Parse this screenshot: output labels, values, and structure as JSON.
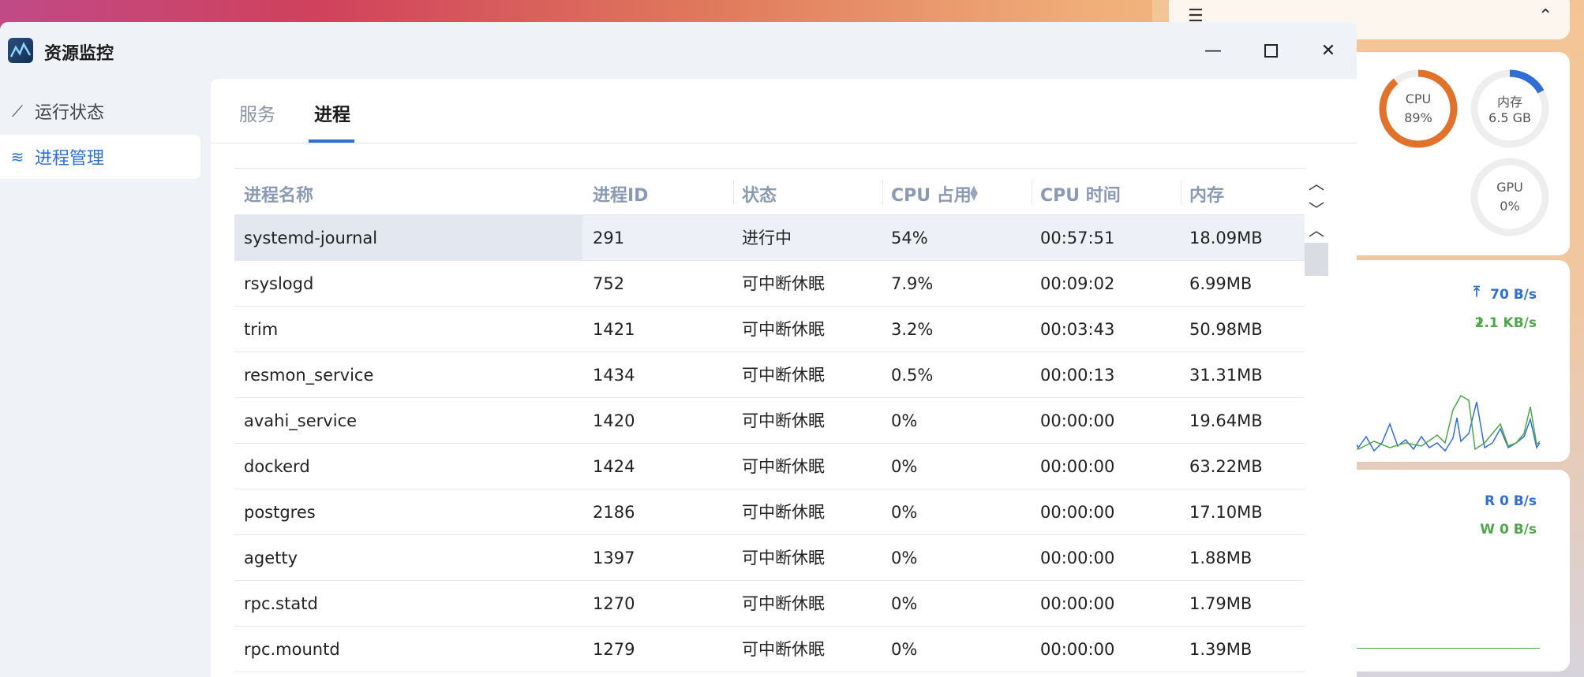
{
  "app": {
    "title": "资源监控"
  },
  "sidebar": {
    "items": [
      {
        "label": "运行状态",
        "icon": "line-chart-icon"
      },
      {
        "label": "进程管理",
        "icon": "layers-icon",
        "active": true
      }
    ]
  },
  "tabs": [
    {
      "label": "服务"
    },
    {
      "label": "进程",
      "active": true
    }
  ],
  "table": {
    "headers": [
      "进程名称",
      "进程ID",
      "状态",
      "CPU 占用",
      "CPU 时间",
      "内存"
    ],
    "sorted_column": "CPU 占用",
    "rows": [
      {
        "name": "systemd-journal",
        "pid": "291",
        "status": "进行中",
        "cpu": "54%",
        "time": "00:57:51",
        "mem": "18.09MB",
        "selected": true
      },
      {
        "name": "rsyslogd",
        "pid": "752",
        "status": "可中断休眠",
        "cpu": "7.9%",
        "time": "00:09:02",
        "mem": "6.99MB"
      },
      {
        "name": "trim",
        "pid": "1421",
        "status": "可中断休眠",
        "cpu": "3.2%",
        "time": "00:03:43",
        "mem": "50.98MB"
      },
      {
        "name": "resmon_service",
        "pid": "1434",
        "status": "可中断休眠",
        "cpu": "0.5%",
        "time": "00:00:13",
        "mem": "31.31MB"
      },
      {
        "name": "avahi_service",
        "pid": "1420",
        "status": "可中断休眠",
        "cpu": "0%",
        "time": "00:00:00",
        "mem": "19.64MB"
      },
      {
        "name": "dockerd",
        "pid": "1424",
        "status": "可中断休眠",
        "cpu": "0%",
        "time": "00:00:00",
        "mem": "63.22MB"
      },
      {
        "name": "postgres",
        "pid": "2186",
        "status": "可中断休眠",
        "cpu": "0%",
        "time": "00:00:00",
        "mem": "17.10MB"
      },
      {
        "name": "agetty",
        "pid": "1397",
        "status": "可中断休眠",
        "cpu": "0%",
        "time": "00:00:00",
        "mem": "1.88MB"
      },
      {
        "name": "rpc.statd",
        "pid": "1270",
        "status": "可中断休眠",
        "cpu": "0%",
        "time": "00:00:00",
        "mem": "1.79MB"
      },
      {
        "name": "rpc.mountd",
        "pid": "1279",
        "status": "可中断休眠",
        "cpu": "0%",
        "time": "00:00:00",
        "mem": "1.39MB"
      }
    ]
  },
  "widgets": {
    "gauges": [
      {
        "label": "CPU",
        "value": "89%",
        "fraction": 0.89,
        "color": "#e0722c"
      },
      {
        "label": "内存",
        "value": "6.5 GB",
        "fraction": 0.17,
        "color": "#2f6fd4"
      },
      {
        "label": "GPU",
        "value": "0%",
        "fraction": 0,
        "color": "#2f6fd4"
      }
    ],
    "network": {
      "upload": "70 B/s",
      "download": "2.1 KB/s"
    },
    "disk": {
      "read": "R  0 B/s",
      "write": "W  0 B/s"
    }
  },
  "colors": {
    "accent": "#2f6fd4",
    "cpu_gauge": "#e0722c",
    "download": "#4ea74a"
  }
}
